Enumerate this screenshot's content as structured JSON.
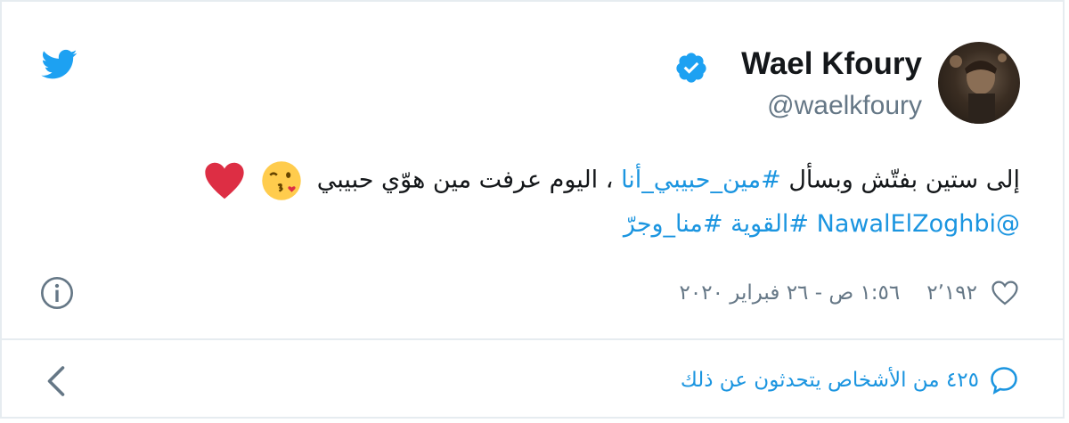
{
  "author": {
    "display_name": "Wael Kfoury",
    "handle": "@waelkfoury",
    "verified": true
  },
  "tweet": {
    "line1_text": "إلى ستين بفتّش وبسأل ",
    "line1_hashtag": "#مين_حبيبي_أنا",
    "line1_rest": " ، اليوم عرفت مين هوّي حبيبي",
    "line2_mention": "@NawalElZoghbi",
    "line2_hashtag1": "#القوية",
    "line2_hashtag2": "#منا_وجرّ"
  },
  "meta": {
    "likes": "٢٬١٩٢",
    "timestamp": "١:٥٦ ص - ٢٦ فبراير ٢٠٢٠"
  },
  "conversation": {
    "label": "٤٢٥ من الأشخاص يتحدثون عن ذلك"
  },
  "icons": {
    "brand": "twitter-bird-icon",
    "verified": "verified-badge-icon",
    "like": "heart-outline-icon",
    "info": "info-icon",
    "reply": "speech-bubble-icon",
    "nav": "chevron-left-icon"
  },
  "colors": {
    "twitter_blue": "#1da1f2",
    "link_blue": "#1b95e0",
    "text": "#14171a",
    "muted": "#657786",
    "heart_red": "#e0245e"
  }
}
